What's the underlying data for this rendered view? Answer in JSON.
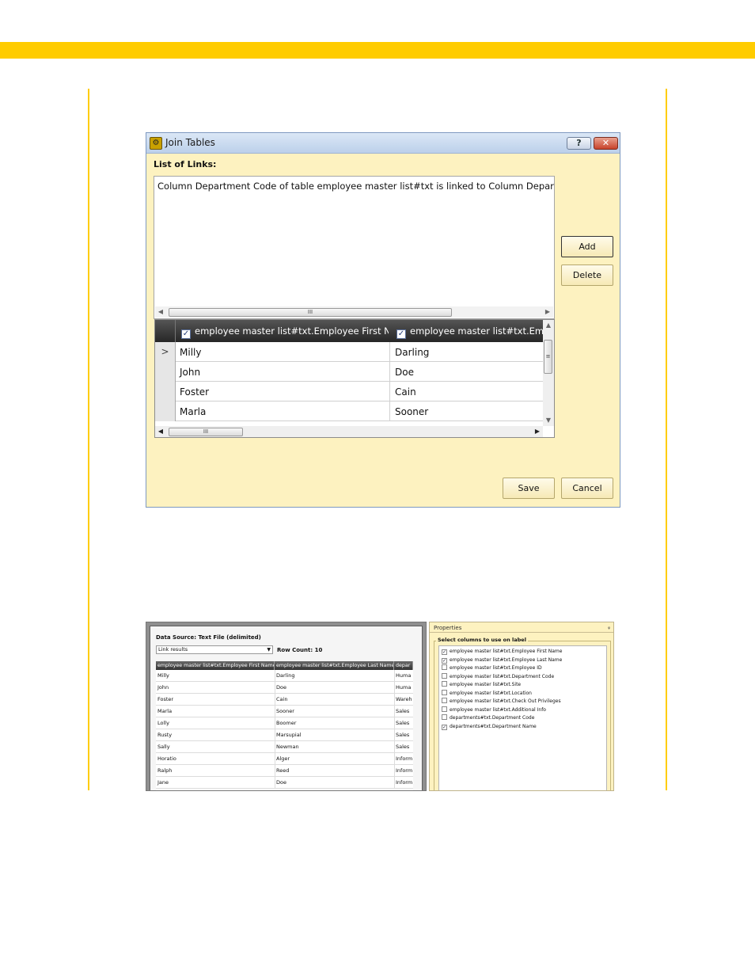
{
  "dialog": {
    "title": "Join Tables",
    "help_label": "?",
    "close_label": "✕",
    "list_label": "List of Links:",
    "link_text": "Column Department Code of table employee master list#txt is linked to Column Department Code",
    "add_label": "Add",
    "delete_label": "Delete",
    "save_label": "Save",
    "cancel_label": "Cancel",
    "scroll_thumb": "III",
    "grid": {
      "columns": [
        "employee master list#txt.Employee First Name",
        "employee master list#txt.Employee Last Name"
      ],
      "row_indicator": ">",
      "rows": [
        [
          "Milly",
          "Darling"
        ],
        [
          "John",
          "Doe"
        ],
        [
          "Foster",
          "Cain"
        ],
        [
          "Marla",
          "Sooner"
        ]
      ]
    }
  },
  "preview": {
    "data_source": "Data Source: Text File (delimited)",
    "select_value": "Link results",
    "row_count": "Row Count: 10",
    "columns": [
      "employee master list#txt.Employee First Name",
      "employee master list#txt.Employee Last Name",
      "depar"
    ],
    "rows": [
      [
        "Milly",
        "Darling",
        "Huma"
      ],
      [
        "John",
        "Doe",
        "Huma"
      ],
      [
        "Foster",
        "Cain",
        "Wareh"
      ],
      [
        "Marla",
        "Sooner",
        "Sales"
      ],
      [
        "Lolly",
        "Boomer",
        "Sales"
      ],
      [
        "Rusty",
        "Marsupial",
        "Sales"
      ],
      [
        "Sally",
        "Newman",
        "Sales"
      ],
      [
        "Horatio",
        "Alger",
        "Inform"
      ],
      [
        "Ralph",
        "Reed",
        "Inform"
      ],
      [
        "Jane",
        "Doe",
        "Inform"
      ]
    ]
  },
  "properties": {
    "title": "Properties",
    "pin": "ᵩ",
    "group_title": "Select columns to use on label",
    "columns": [
      {
        "label": "employee master list#txt.Employee First Name",
        "checked": "✓"
      },
      {
        "label": "employee master list#txt.Employee Last Name",
        "checked": "✓"
      },
      {
        "label": "employee master list#txt.Employee ID",
        "checked": ""
      },
      {
        "label": "employee master list#txt.Department Code",
        "checked": ""
      },
      {
        "label": "employee master list#txt.Site",
        "checked": ""
      },
      {
        "label": "employee master list#txt.Location",
        "checked": ""
      },
      {
        "label": "employee master list#txt.Check Out Privileges",
        "checked": ""
      },
      {
        "label": "employee master list#txt.Additional Info",
        "checked": ""
      },
      {
        "label": "departments#txt.Department Code",
        "checked": ""
      },
      {
        "label": "departments#txt.Department Name",
        "checked": "✓"
      }
    ]
  },
  "colors": {
    "accent": "#ffcc00",
    "dialog_bg": "#fdf2c0"
  }
}
